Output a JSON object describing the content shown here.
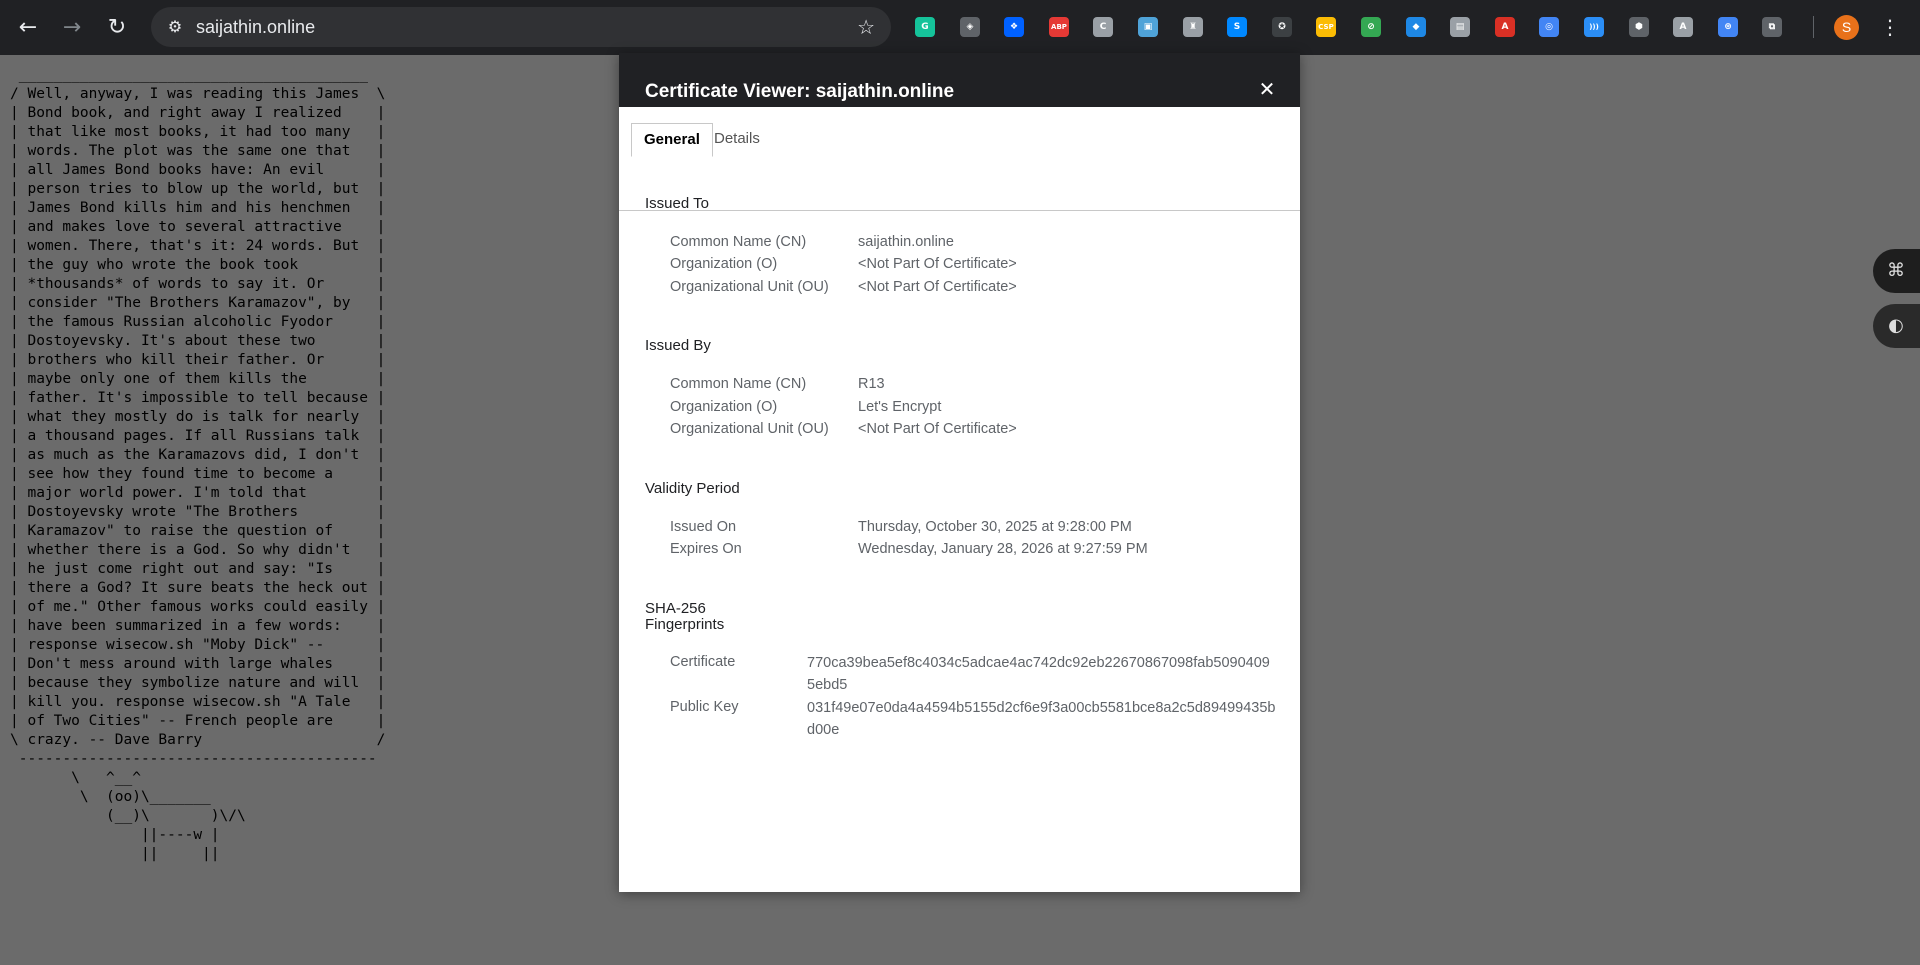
{
  "browser": {
    "url": "saijathin.online",
    "back_icon": "←",
    "forward_icon": "→",
    "reload_icon": "↻",
    "site_info_icon": "⚙",
    "star_icon": "☆",
    "profile_initial": "S",
    "menu_icon": "⋮",
    "extensions": [
      {
        "name": "grammarly-extension-icon",
        "glyph": "G",
        "color": "#15c39a"
      },
      {
        "name": "shield-extension-icon",
        "glyph": "◈",
        "color": "#5f6368"
      },
      {
        "name": "dropbox-extension-icon",
        "glyph": "❖",
        "color": "#0061ff"
      },
      {
        "name": "adblock-plus-extension-icon",
        "glyph": "ABP",
        "color": "#e53935"
      },
      {
        "name": "c-extension-icon",
        "glyph": "C",
        "color": "#9aa0a6"
      },
      {
        "name": "clipboard-extension-icon",
        "glyph": "▣",
        "color": "#4fa3d8"
      },
      {
        "name": "robot-extension-icon",
        "glyph": "♜",
        "color": "#9aa0a6"
      },
      {
        "name": "shazam-extension-icon",
        "glyph": "S",
        "color": "#0088ff"
      },
      {
        "name": "cow-extension-icon",
        "glyph": "✪",
        "color": "#3c4043"
      },
      {
        "name": "csp-extension-icon",
        "glyph": "CSP",
        "color": "#fbbc04"
      },
      {
        "name": "link-extension-icon",
        "glyph": "⊘",
        "color": "#34a853"
      },
      {
        "name": "diamond-extension-icon",
        "glyph": "◆",
        "color": "#1e88e5"
      },
      {
        "name": "image-extension-icon",
        "glyph": "▤",
        "color": "#9aa0a6"
      },
      {
        "name": "pdf-extension-icon",
        "glyph": "A",
        "color": "#d93025"
      },
      {
        "name": "circle-extension-icon",
        "glyph": "◎",
        "color": "#4285f4"
      },
      {
        "name": "wave-extension-icon",
        "glyph": ")))",
        "color": "#2b8ef6"
      },
      {
        "name": "security-extension-icon",
        "glyph": "⬢",
        "color": "#5f6368"
      },
      {
        "name": "a-extension-icon",
        "glyph": "A",
        "color": "#9aa0a6"
      },
      {
        "name": "swirl-extension-icon",
        "glyph": "⊛",
        "color": "#4285f4"
      },
      {
        "name": "puzzle-extensions-icon",
        "glyph": "⧉",
        "color": "#5f6368"
      }
    ]
  },
  "page": {
    "cowsay": " ________________________________________\n/ Well, anyway, I was reading this James  \\\n| Bond book, and right away I realized    |\n| that like most books, it had too many   |\n| words. The plot was the same one that   |\n| all James Bond books have: An evil      |\n| person tries to blow up the world, but  |\n| James Bond kills him and his henchmen   |\n| and makes love to several attractive    |\n| women. There, that's it: 24 words. But  |\n| the guy who wrote the book took         |\n| *thousands* of words to say it. Or      |\n| consider \"The Brothers Karamazov\", by   |\n| the famous Russian alcoholic Fyodor     |\n| Dostoyevsky. It's about these two       |\n| brothers who kill their father. Or      |\n| maybe only one of them kills the        |\n| father. It's impossible to tell because |\n| what they mostly do is talk for nearly  |\n| a thousand pages. If all Russians talk  |\n| as much as the Karamazovs did, I don't  |\n| see how they found time to become a     |\n| major world power. I'm told that        |\n| Dostoyevsky wrote \"The Brothers         |\n| Karamazov\" to raise the question of     |\n| whether there is a God. So why didn't   |\n| he just come right out and say: \"Is     |\n| there a God? It sure beats the heck out |\n| of me.\" Other famous works could easily |\n| have been summarized in a few words:    |\n| response wisecow.sh \"Moby Dick\" --      |\n| Don't mess around with large whales     |\n| because they symbolize nature and will  |\n| kill you. response wisecow.sh \"A Tale   |\n| of Two Cities\" -- French people are     |\n\\ crazy. -- Dave Barry                    /\n -----------------------------------------\n       \\   ^__^\n        \\  (oo)\\_______\n           (__)\\       )\\/\\\n               ||----w |\n               ||     ||",
    "side_widgets": [
      {
        "name": "grid-widget-icon",
        "glyph": "⌘"
      },
      {
        "name": "assistant-widget-icon",
        "glyph": "◐"
      }
    ]
  },
  "dialog": {
    "title": "Certificate Viewer: saijathin.online",
    "close_icon": "✕",
    "tabs": [
      {
        "label": "General",
        "active": true
      },
      {
        "label": "Details",
        "active": false
      }
    ],
    "issued_to": {
      "title": "Issued To",
      "rows": [
        {
          "label": "Common Name (CN)",
          "value": "saijathin.online"
        },
        {
          "label": "Organization (O)",
          "value": "<Not Part Of Certificate>"
        },
        {
          "label": "Organizational Unit (OU)",
          "value": "<Not Part Of Certificate>"
        }
      ]
    },
    "issued_by": {
      "title": "Issued By",
      "rows": [
        {
          "label": "Common Name (CN)",
          "value": "R13"
        },
        {
          "label": "Organization (O)",
          "value": "Let's Encrypt"
        },
        {
          "label": "Organizational Unit (OU)",
          "value": "<Not Part Of Certificate>"
        }
      ]
    },
    "validity": {
      "title": "Validity Period",
      "rows": [
        {
          "label": "Issued On",
          "value": "Thursday, October 30, 2025 at 9:28:00 PM"
        },
        {
          "label": "Expires On",
          "value": "Wednesday, January 28, 2026 at 9:27:59 PM"
        }
      ]
    },
    "fingerprints": {
      "title_line1": "SHA-256",
      "title_line2": "Fingerprints",
      "rows": [
        {
          "label": "Certificate",
          "value": "770ca39bea5ef8c4034c5adcae4ac742dc92eb22670867098fab50904095ebd5"
        },
        {
          "label": "Public Key",
          "value": "031f49e07e0da4a4594b5155d2cf6e9f3a00cb5581bce8a2c5d89499435bd00e"
        }
      ]
    }
  }
}
